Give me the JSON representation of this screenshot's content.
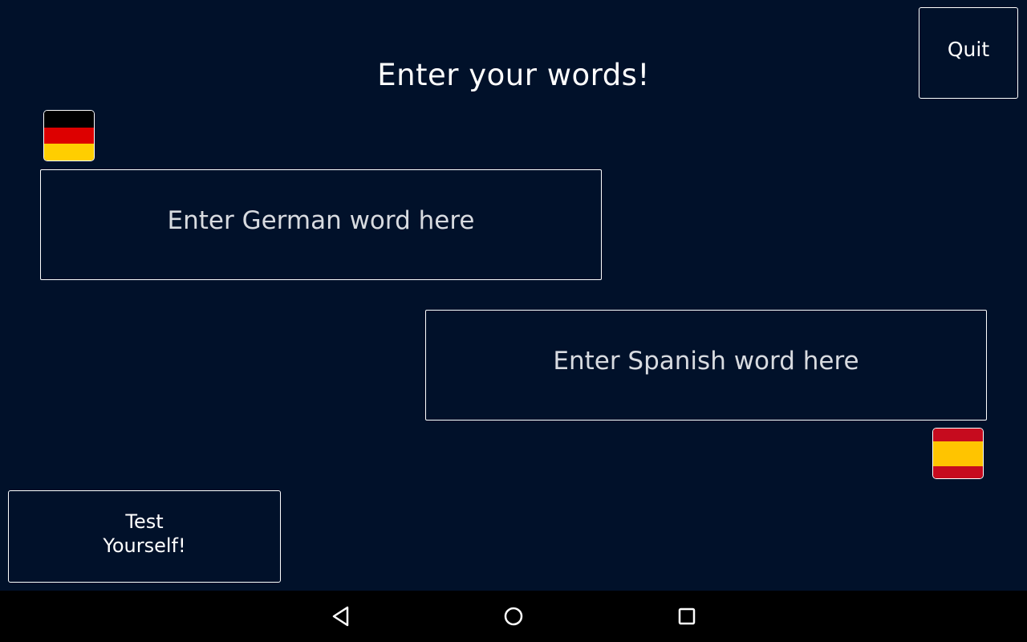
{
  "header": {
    "title": "Enter your words!",
    "quit_label": "Quit"
  },
  "german": {
    "flag": "german-flag-icon",
    "placeholder": "Enter German word here",
    "value": "",
    "flag_colors": [
      "#000000",
      "#dd0000",
      "#ffce00"
    ]
  },
  "spanish": {
    "flag": "spanish-flag-icon",
    "placeholder": "Enter Spanish word here",
    "value": "",
    "flag_colors": [
      "#c60b1e",
      "#ffc400",
      "#c60b1e"
    ]
  },
  "test_button": {
    "line1": "Test",
    "line2": "Yourself!"
  },
  "navbar": {
    "back": "back-triangle-icon",
    "home": "home-circle-icon",
    "recents": "recents-square-icon"
  },
  "colors": {
    "background": "#01112a",
    "foreground": "#ffffff",
    "navbar": "#000000"
  }
}
